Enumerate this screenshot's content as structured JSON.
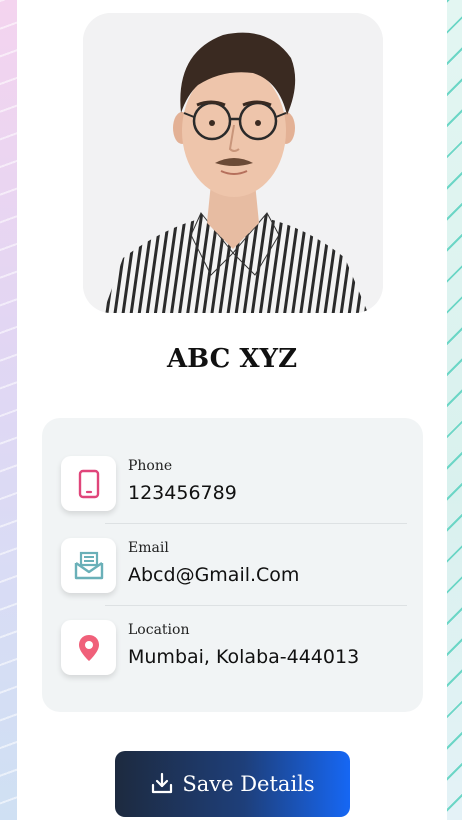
{
  "profile": {
    "name": "ABC XYZ",
    "photo_description_icon": "profile-photo"
  },
  "contact": [
    {
      "label": "Phone",
      "value": "123456789",
      "icon": "phone-icon",
      "color": "#e0457a"
    },
    {
      "label": "Email",
      "value": "Abcd@Gmail.Com",
      "icon": "email-icon",
      "color": "#6ab0b8"
    },
    {
      "label": "Location",
      "value": "Mumbai, Kolaba-444013",
      "icon": "location-pin-icon",
      "color": "#f0607a"
    }
  ],
  "actions": {
    "save_label": "Save Details",
    "save_icon": "download-icon"
  },
  "colors": {
    "button_start": "#1d2a3f",
    "button_end": "#1667f4",
    "info_bg": "#f1f4f5"
  }
}
